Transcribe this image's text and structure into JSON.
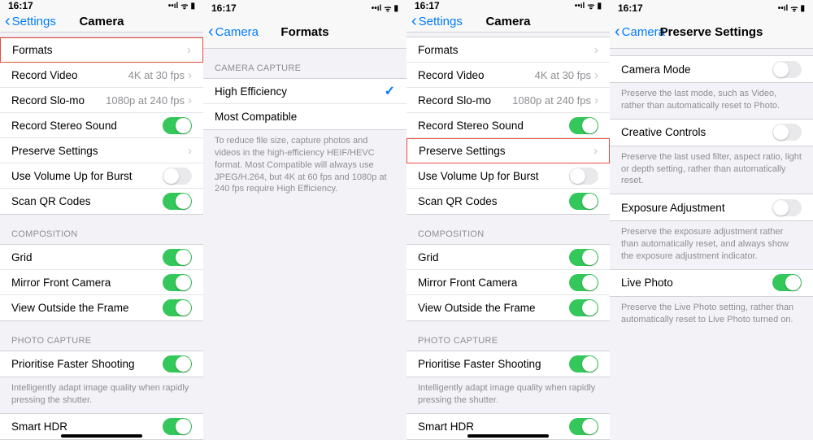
{
  "status": {
    "time": "16:17",
    "signal": "••ıl",
    "wifi": "ᯤ",
    "battery": "▮"
  },
  "s1": {
    "back": "Settings",
    "title": "Camera",
    "rows_top": [
      {
        "label": "Formats",
        "detail": "",
        "nav": true
      },
      {
        "label": "Record Video",
        "detail": "4K at 30 fps",
        "nav": true
      },
      {
        "label": "Record Slo-mo",
        "detail": "1080p at 240 fps",
        "nav": true
      },
      {
        "label": "Record Stereo Sound",
        "toggle": "on"
      },
      {
        "label": "Preserve Settings",
        "nav": true
      },
      {
        "label": "Use Volume Up for Burst",
        "toggle": "off"
      },
      {
        "label": "Scan QR Codes",
        "toggle": "on"
      }
    ],
    "comp_header": "COMPOSITION",
    "rows_comp": [
      {
        "label": "Grid",
        "toggle": "on"
      },
      {
        "label": "Mirror Front Camera",
        "toggle": "on"
      },
      {
        "label": "View Outside the Frame",
        "toggle": "on"
      }
    ],
    "photo_header": "PHOTO CAPTURE",
    "rows_photo": [
      {
        "label": "Prioritise Faster Shooting",
        "toggle": "on"
      }
    ],
    "photo_footer": "Intelligently adapt image quality when rapidly pressing the shutter.",
    "rows_bottom": [
      {
        "label": "Smart HDR",
        "toggle": "on"
      }
    ]
  },
  "s2": {
    "back": "Camera",
    "title": "Formats",
    "cap_header": "CAMERA CAPTURE",
    "rows": [
      {
        "label": "High Efficiency",
        "selected": true
      },
      {
        "label": "Most Compatible",
        "selected": false
      }
    ],
    "footer": "To reduce file size, capture photos and videos in the high-efficiency HEIF/HEVC format. Most Compatible will always use JPEG/H.264, but 4K at 60 fps and 1080p at 240 fps require High Efficiency."
  },
  "s3": {
    "back": "Settings",
    "title": "Camera"
  },
  "s4": {
    "back": "Camera",
    "title": "Preserve Settings",
    "items": [
      {
        "label": "Camera Mode",
        "toggle": "off",
        "footer": "Preserve the last mode, such as Video, rather than automatically reset to Photo."
      },
      {
        "label": "Creative Controls",
        "toggle": "off",
        "footer": "Preserve the last used filter, aspect ratio, light or depth setting, rather than automatically reset."
      },
      {
        "label": "Exposure Adjustment",
        "toggle": "off",
        "footer": "Preserve the exposure adjustment rather than automatically reset, and always show the exposure adjustment indicator."
      },
      {
        "label": "Live Photo",
        "toggle": "on",
        "footer": "Preserve the Live Photo setting, rather than automatically reset to Live Photo turned on."
      }
    ]
  }
}
